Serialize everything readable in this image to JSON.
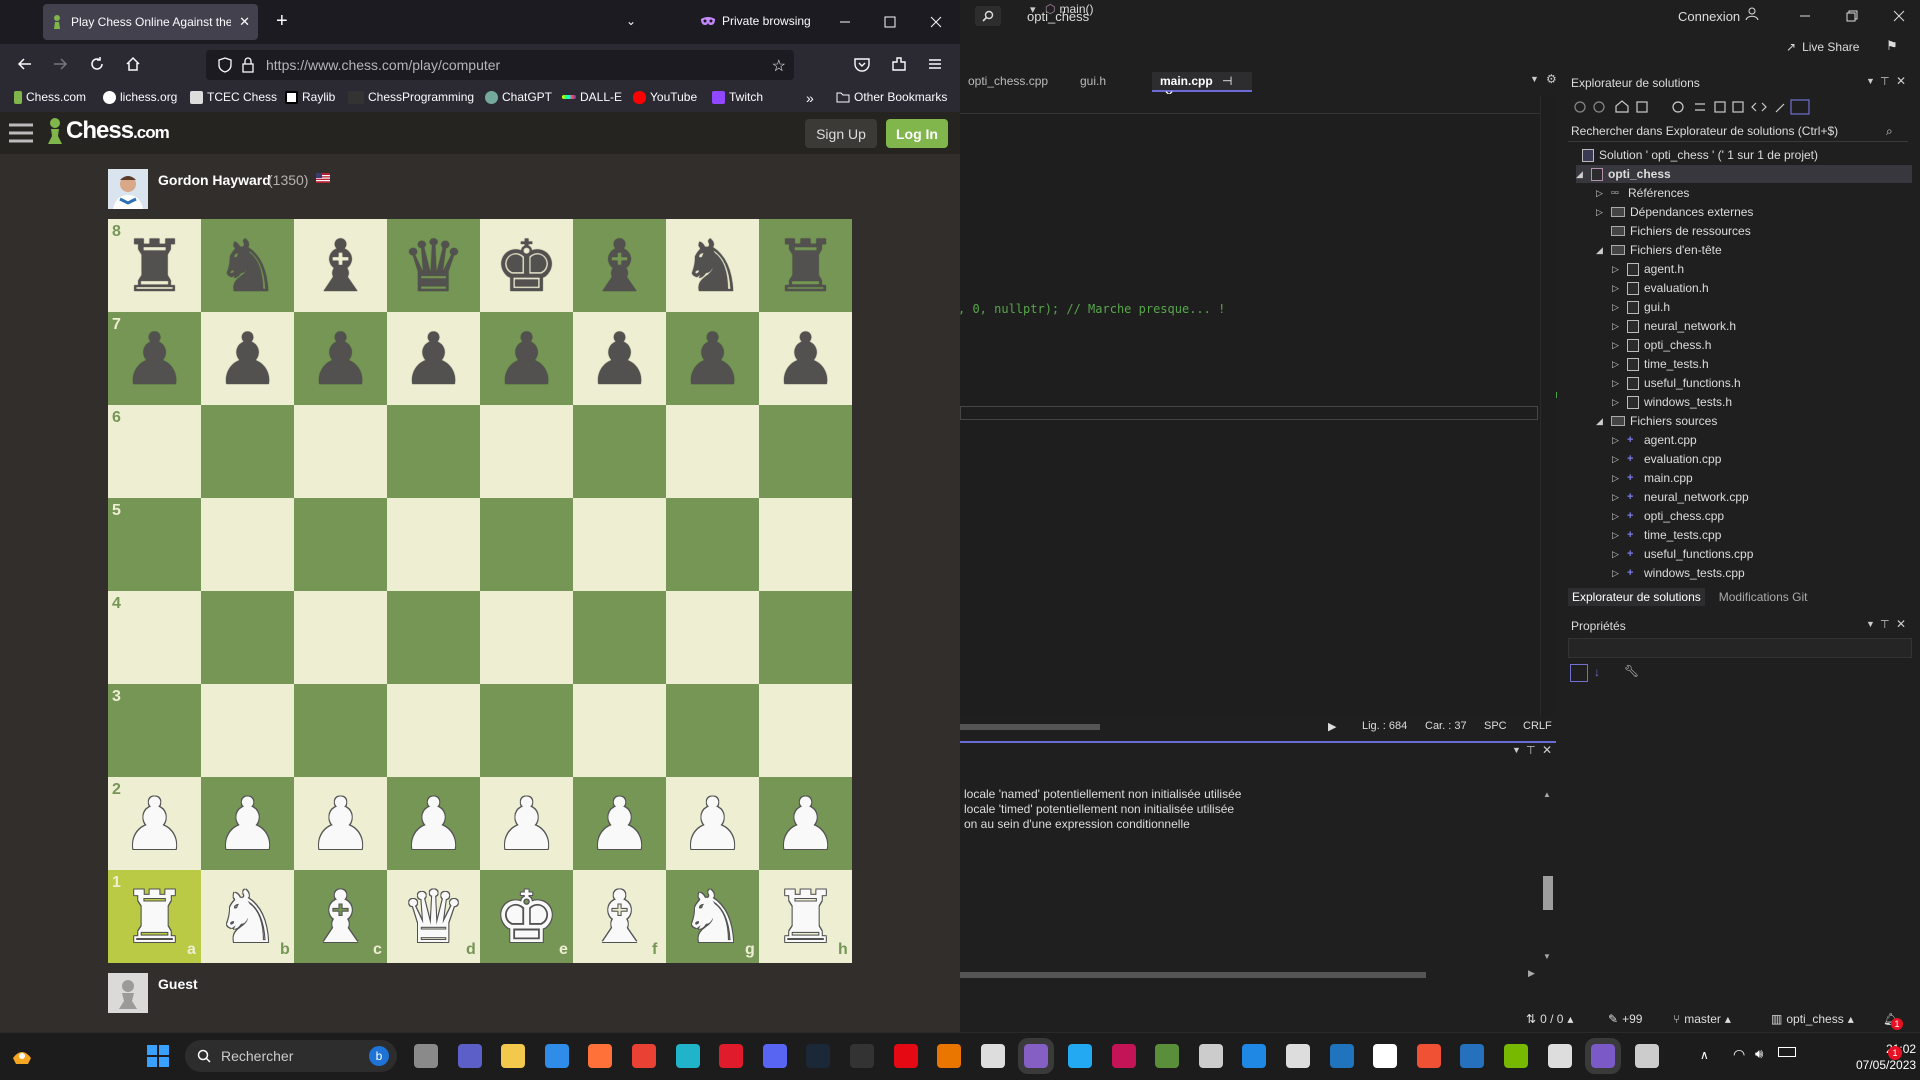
{
  "vs": {
    "title": "opti_chess",
    "login": "Connexion",
    "live_share": "Live Share",
    "tabs": [
      "opti_chess.cpp",
      "gui.h",
      "main.cpp"
    ],
    "active_tab": "main.cpp",
    "nav_function": "main()",
    "code_line": ", 0, nullptr); // Marche presque... !",
    "status": {
      "line": "Lig. : 684",
      "col": "Car. : 37",
      "spc": "SPC",
      "crlf": "CRLF"
    },
    "output_lines": [
      "locale 'named' potentiellement non initialisée utilisée",
      "locale 'timed' potentiellement non initialisée utilisée",
      "on au sein d'une expression conditionnelle"
    ],
    "statusbar": {
      "changes": "0 / 0",
      "edits": "+99",
      "branch": "master",
      "repo": "opti_chess",
      "notif": "1"
    },
    "solution_explorer": {
      "title": "Explorateur de solutions",
      "search_placeholder": "Rechercher dans Explorateur de solutions (Ctrl+$)",
      "solution": "Solution ' opti_chess ' (' 1 sur 1 de projet)",
      "project": "opti_chess",
      "nodes": {
        "refs": "Références",
        "deps": "Dépendances externes",
        "res": "Fichiers de ressources",
        "headers": "Fichiers d'en-tête",
        "sources": "Fichiers sources"
      },
      "headers": [
        "agent.h",
        "evaluation.h",
        "gui.h",
        "neural_network.h",
        "opti_chess.h",
        "time_tests.h",
        "useful_functions.h",
        "windows_tests.h"
      ],
      "sources": [
        "agent.cpp",
        "evaluation.cpp",
        "main.cpp",
        "neural_network.cpp",
        "opti_chess.cpp",
        "time_tests.cpp",
        "useful_functions.cpp",
        "windows_tests.cpp"
      ],
      "tab1": "Explorateur de solutions",
      "tab2": "Modifications Git"
    },
    "properties_title": "Propriétés"
  },
  "firefox": {
    "tab_title": "Play Chess Online Against the C",
    "private": "Private browsing",
    "url": "https://www.chess.com/play/computer",
    "bookmarks": [
      "Chess.com",
      "lichess.org",
      "TCEC Chess",
      "Raylib",
      "ChessProgramming",
      "ChatGPT",
      "DALL-E",
      "YouTube",
      "Twitch"
    ],
    "other_bookmarks": "Other Bookmarks"
  },
  "chess": {
    "logo": "Chess",
    "logo_suffix": ".com",
    "signup": "Sign Up",
    "login": "Log In",
    "opponent": {
      "name": "Gordon Hayward",
      "rating": "(1350)"
    },
    "player": {
      "name": "Guest"
    },
    "ranks": [
      "8",
      "7",
      "6",
      "5",
      "4",
      "3",
      "2",
      "1"
    ],
    "files": [
      "a",
      "b",
      "c",
      "d",
      "e",
      "f",
      "g",
      "h"
    ],
    "board": [
      [
        "br",
        "bn",
        "bb",
        "bq",
        "bk",
        "bb",
        "bn",
        "br"
      ],
      [
        "bp",
        "bp",
        "bp",
        "bp",
        "bp",
        "bp",
        "bp",
        "bp"
      ],
      [
        "",
        "",
        "",
        "",
        "",
        "",
        "",
        ""
      ],
      [
        "",
        "",
        "",
        "",
        "",
        "",
        "",
        ""
      ],
      [
        "",
        "",
        "",
        "",
        "",
        "",
        "",
        ""
      ],
      [
        "",
        "",
        "",
        "",
        "",
        "",
        "",
        ""
      ],
      [
        "wp",
        "wp",
        "wp",
        "wp",
        "wp",
        "wp",
        "wp",
        "wp"
      ],
      [
        "wr",
        "wn",
        "wb",
        "wq",
        "wk",
        "wb",
        "wn",
        "wr"
      ]
    ],
    "highlight": "a1",
    "colors": {
      "light": "#eeeed2",
      "dark": "#769656",
      "highlight": "#baca44",
      "accent": "#81b64c"
    }
  },
  "taskbar": {
    "search": "Rechercher",
    "time": "21:02",
    "date": "07/05/2023"
  }
}
